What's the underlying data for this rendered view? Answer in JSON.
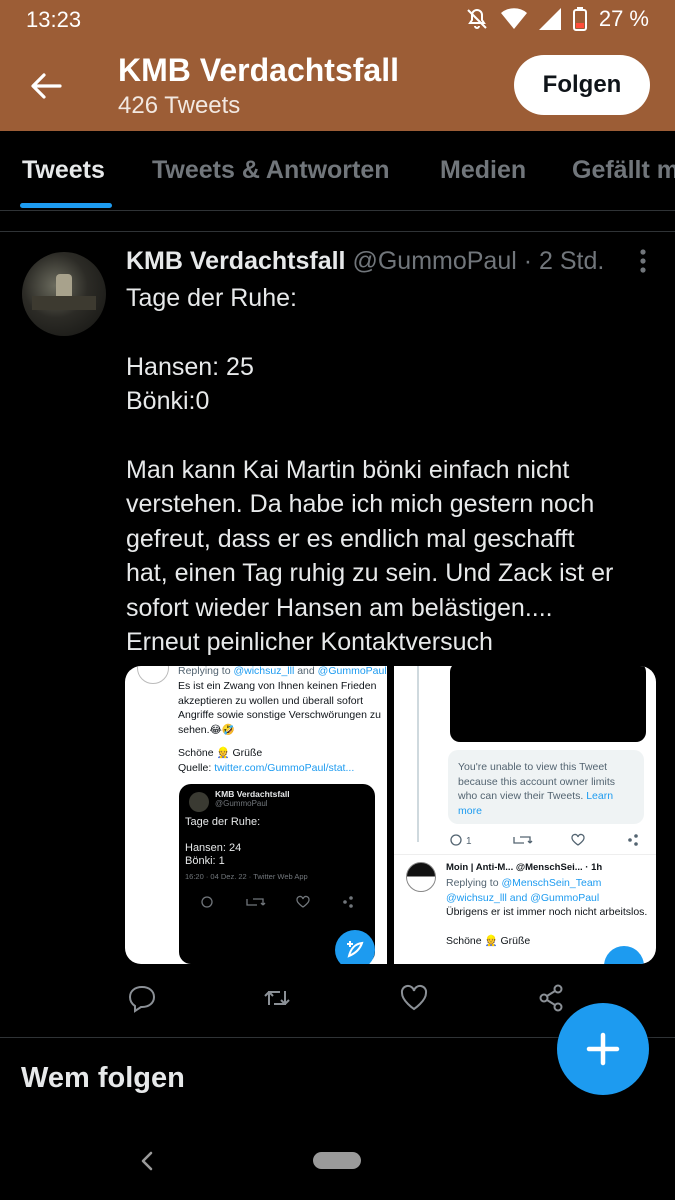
{
  "status_bar": {
    "time": "13:23",
    "battery": "27 %"
  },
  "header": {
    "title": "KMB Verdachtsfall",
    "subtitle": "426 Tweets",
    "follow_label": "Folgen"
  },
  "tabs": [
    "Tweets",
    "Tweets & Antworten",
    "Medien",
    "Gefällt mir"
  ],
  "tweet": {
    "name": "KMB Verdachtsfall",
    "handle": "@GummoPaul",
    "dot": "·",
    "time": "2 Std.",
    "lines": [
      "Tage der Ruhe:",
      "",
      "Hansen: 25",
      "Bönki:0",
      "",
      "Man kann Kai Martin bönki einfach nicht",
      "verstehen. Da habe ich mich gestern noch",
      "gefreut, dass er es endlich mal geschafft",
      "hat, einen Tag ruhig zu sein. Und Zack ist er",
      "sofort wieder Hansen am belästigen....",
      "Erneut peinlicher Kontaktversuch"
    ]
  },
  "media": {
    "shot1": {
      "replying_prefix": "Replying to ",
      "replying_a": "@wichsuz_lll",
      "replying_and": " and ",
      "replying_b": "@GummoPaul",
      "body": "Es ist ein Zwang von Ihnen keinen Frieden akzeptieren zu wollen und überall sofort Angriffe sowie sonstige Verschwörungen zu sehen.😂🤣",
      "gruss": "Schöne 👷 Grüße",
      "quelle_label": "Quelle: ",
      "quelle_link": "twitter.com/GummoPaul/stat...",
      "card_name": "KMB Verdachtsfall",
      "card_handle": "@GummoPaul",
      "card_l1": "Tage der Ruhe:",
      "card_l2": "Hansen: 24",
      "card_l3": "Bönki: 1",
      "card_meta": "16:20 · 04 Dez. 22 · Twitter Web App"
    },
    "shot2": {
      "unavailable_a": "You're unable to view this Tweet because this account owner limits who can view their Tweets. ",
      "unavailable_link": "Learn more",
      "reply_count": "1",
      "name_line": "Moin | Anti-M...  @MenschSei... · 1h",
      "replying_prefix": "Replying to ",
      "replying_a": "@MenschSein_Team",
      "replying_b": "@wichsuz_lll and @GummoPaul",
      "body": "Übrigens er ist immer noch nicht arbeitslos.",
      "gruss": "Schöne 👷 Grüße"
    }
  },
  "section": {
    "who_to_follow": "Wem folgen"
  },
  "colors": {
    "header_bg": "#9c5d36",
    "accent": "#1d9bf0",
    "background": "#000000"
  }
}
